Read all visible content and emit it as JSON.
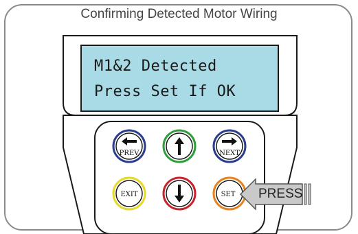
{
  "title": "Confirming Detected Motor Wiring",
  "lcd": {
    "line1": "M1&2 Detected",
    "line2": "Press Set If OK"
  },
  "buttons": {
    "prev": "PREV",
    "next": "NEXT",
    "exit": "EXIT",
    "set": "SET"
  },
  "callout": {
    "label": "PRESS"
  },
  "colors": {
    "lcd_screen": "#a9dbe6",
    "prev_ring": "#2b3d8f",
    "up_ring": "#2e9e3a",
    "next_ring": "#2b3d8f",
    "exit_ring": "#e5d92a",
    "down_ring": "#c8232c",
    "set_ring": "#e8821e"
  }
}
